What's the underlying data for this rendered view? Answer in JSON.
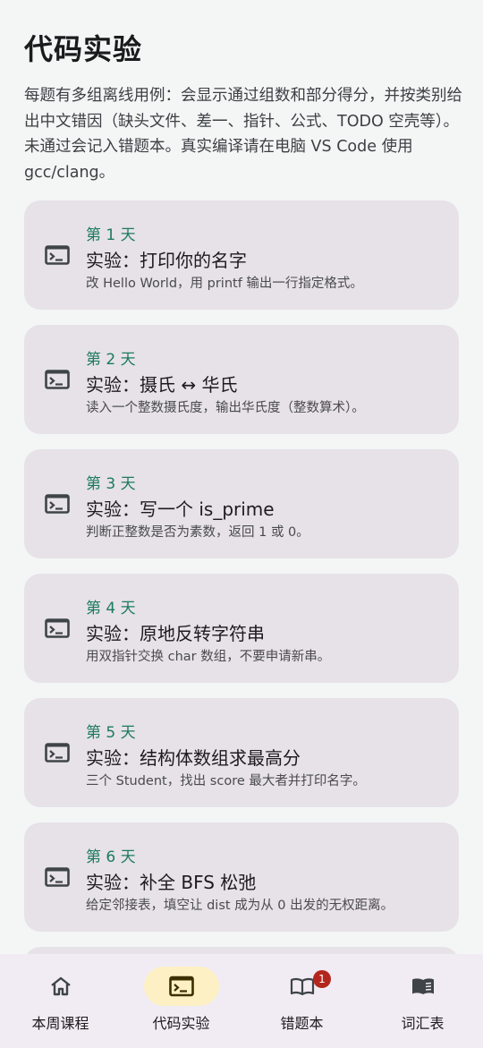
{
  "page": {
    "title": "代码实验",
    "description": "每题有多组离线用例：会显示通过组数和部分得分，并按类别给出中文错因（缺头文件、差一、指针、公式、TODO 空壳等）。未通过会记入错题本。真实编译请在电脑 VS Code 使用 gcc/clang。"
  },
  "labs": [
    {
      "day": "第 1 天",
      "name": "实验：打印你的名字",
      "desc": "改 Hello World，用 printf 输出一行指定格式。",
      "icon": "terminal-icon"
    },
    {
      "day": "第 2 天",
      "name": "实验：摄氏 ↔ 华氏",
      "desc": "读入一个整数摄氏度，输出华氏度（整数算术）。",
      "icon": "terminal-icon"
    },
    {
      "day": "第 3 天",
      "name": "实验：写一个 is_prime",
      "desc": "判断正整数是否为素数，返回 1 或 0。",
      "icon": "terminal-icon"
    },
    {
      "day": "第 4 天",
      "name": "实验：原地反转字符串",
      "desc": "用双指针交换 char 数组，不要申请新串。",
      "icon": "terminal-icon"
    },
    {
      "day": "第 5 天",
      "name": "实验：结构体数组求最高分",
      "desc": "三个 Student，找出 score 最大者并打印名字。",
      "icon": "terminal-icon"
    },
    {
      "day": "第 6 天",
      "name": "实验：补全 BFS 松弛",
      "desc": "给定邻接表，填空让 dist 成为从 0 出发的无权距离。",
      "icon": "terminal-icon"
    }
  ],
  "nav": {
    "items": [
      {
        "label": "本周课程",
        "icon": "home-icon",
        "active": false
      },
      {
        "label": "代码实验",
        "icon": "terminal-icon",
        "active": true
      },
      {
        "label": "错题本",
        "icon": "book-open-icon",
        "active": false,
        "badge": "1"
      },
      {
        "label": "词汇表",
        "icon": "book-icon",
        "active": false
      }
    ]
  },
  "colors": {
    "accent_green": "#1e7a5f",
    "card_bg": "#e6e2e7",
    "nav_bg": "#f1ecf4",
    "active_pill": "#fdf0c4",
    "badge_red": "#b3261e"
  }
}
